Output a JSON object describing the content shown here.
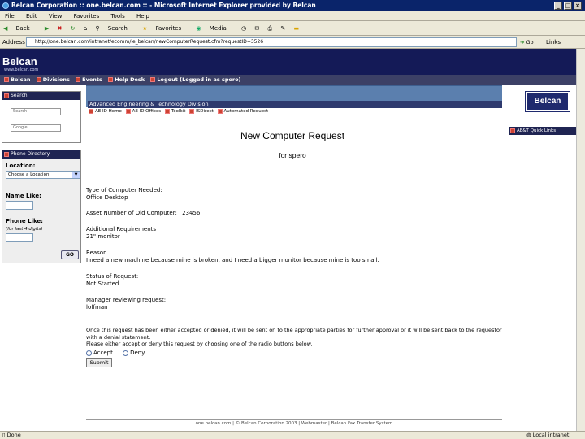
{
  "window": {
    "title": "Belcan Corporation :: one.belcan.com :: - Microsoft Internet Explorer provided by Belcan"
  },
  "menu": [
    "File",
    "Edit",
    "View",
    "Favorites",
    "Tools",
    "Help"
  ],
  "toolbar": {
    "back": "Back",
    "search": "Search",
    "favorites": "Favorites",
    "media": "Media"
  },
  "address": {
    "label": "Address",
    "url": "http://one.belcan.com/intranet/ecomm/ie_belcan/newComputerRequest.cfm?requestID=3526",
    "go": "Go",
    "links": "Links"
  },
  "site": {
    "logo": "Belcan",
    "logo_sub": "www.belcan.com",
    "nav": [
      "Belcan",
      "Divisions",
      "Events",
      "Help Desk",
      "Logout (Logged in as spero)"
    ]
  },
  "search_box": {
    "title": "Search",
    "field1": "Search",
    "field2": "Google"
  },
  "phone_dir": {
    "title": "Phone Directory",
    "location_label": "Location:",
    "location_value": "Choose a Location",
    "name_label": "Name Like:",
    "phone_label": "Phone Like:",
    "phone_hint": "(for last 4 digits)",
    "go": "GO"
  },
  "division": {
    "title": "Advanced Engineering & Technology Division",
    "links": [
      "AE ID Home",
      "AE ID Offices",
      "Toolkit",
      "ISDirect",
      "Automated Request"
    ]
  },
  "belcan_button": "Belcan",
  "right_links": "AE&T Quick Links",
  "page": {
    "title": "New Computer Request",
    "subtitle": "for spero"
  },
  "fields": {
    "type_label": "Type of Computer Needed:",
    "type_value": "Office Desktop",
    "asset_label": "Asset Number of Old Computer:",
    "asset_value": "23456",
    "addl_label": "Additional Requirements",
    "addl_value": "21\" monitor",
    "reason_label": "Reason",
    "reason_value": "I need a new machine because mine is broken, and I need a bigger monitor because mine is too small.",
    "status_label": "Status of Request:",
    "status_value": "Not Started",
    "mgr_label": "Manager reviewing request:",
    "mgr_value": "loffman"
  },
  "instructions": {
    "line1": "Once this request has been either accepted or denied, it will be sent on to the appropriate parties for further approval or it will be sent back to the requestor",
    "line2": "with a denial statement.",
    "line3": "Please either accept or deny this request by choosing one of the radio buttons below."
  },
  "approval": {
    "accept": "Accept",
    "deny": "Deny",
    "submit": "Submit"
  },
  "footer": "one.belcan.com  |  © Belcan Corporation 2003  |  Webmaster  |  Belcan Fax Transfer System",
  "status_bar": {
    "left": "Done",
    "right": "Local intranet"
  }
}
